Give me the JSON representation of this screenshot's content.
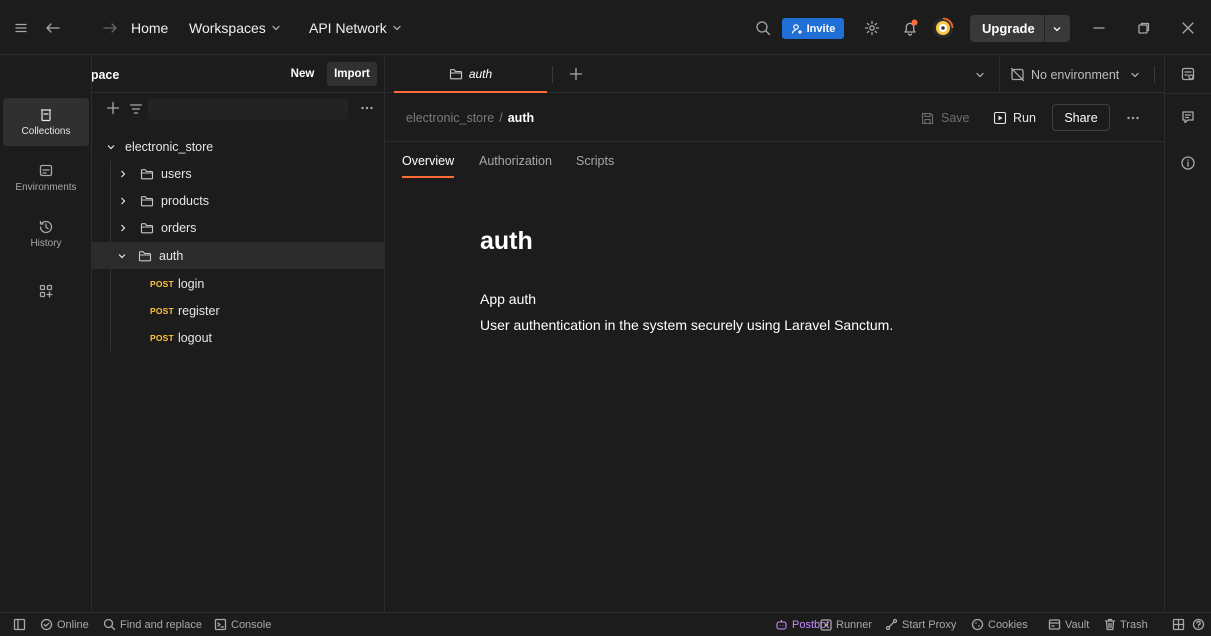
{
  "titlebar": {
    "home": "Home",
    "workspaces": "Workspaces",
    "api_network": "API Network",
    "invite": "Invite",
    "upgrade": "Upgrade"
  },
  "workspace": {
    "name": "My Workspace",
    "new_label": "New",
    "import_label": "Import"
  },
  "rail": {
    "collections": "Collections",
    "environments": "Environments",
    "history": "History"
  },
  "tree": {
    "root": "electronic_store",
    "folders": [
      "users",
      "products",
      "orders",
      "auth"
    ],
    "method": "POST",
    "requests": [
      "login",
      "register",
      "logout"
    ]
  },
  "tab": {
    "label": "auth",
    "environment": "No environment"
  },
  "breadcrumb": {
    "parent": "electronic_store",
    "sep": "/",
    "current": "auth"
  },
  "toolbar": {
    "save": "Save",
    "run": "Run",
    "share": "Share"
  },
  "subtabs": [
    "Overview",
    "Authorization",
    "Scripts"
  ],
  "overview": {
    "title": "auth",
    "subtitle": "App auth",
    "description": "User authentication in the system securely using Laravel Sanctum."
  },
  "status": {
    "online": "Online",
    "find": "Find and replace",
    "console": "Console",
    "postbot": "Postbot",
    "runner": "Runner",
    "proxy": "Start Proxy",
    "cookies": "Cookies",
    "vault": "Vault",
    "trash": "Trash"
  },
  "colors": {
    "accent": "#ff6c37",
    "invite": "#1f6fd6",
    "postbot": "#c58cff",
    "post_method": "#ffc23d"
  }
}
